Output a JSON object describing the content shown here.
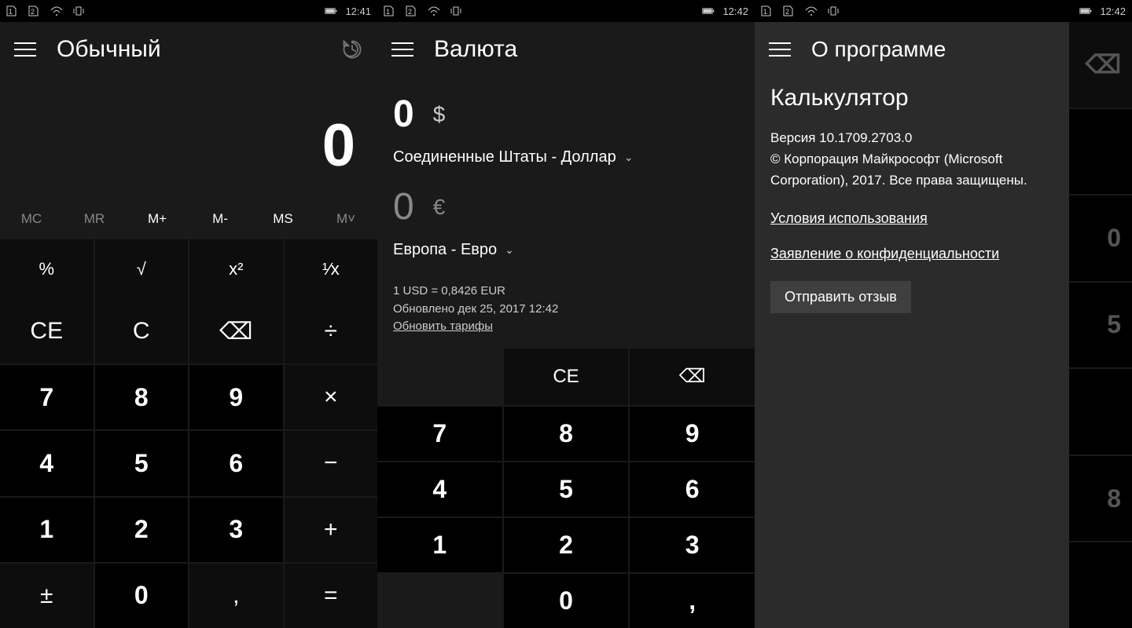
{
  "status": {
    "time1": "12:41",
    "time2": "12:42",
    "time3": "12:42"
  },
  "panel1": {
    "title": "Обычный",
    "display": "0",
    "mem": {
      "mc": "MC",
      "mr": "MR",
      "mplus": "M+",
      "mminus": "M-",
      "ms": "MS",
      "mv": "M˅"
    },
    "fn": {
      "pct": "%",
      "sqrt": "√",
      "sq": "x²",
      "inv": "¹∕x"
    },
    "keys": {
      "ce": "CE",
      "c": "C",
      "bs": "⌫",
      "div": "÷",
      "k7": "7",
      "k8": "8",
      "k9": "9",
      "mul": "×",
      "k4": "4",
      "k5": "5",
      "k6": "6",
      "sub": "−",
      "k1": "1",
      "k2": "2",
      "k3": "3",
      "add": "+",
      "pm": "±",
      "k0": "0",
      "dec": ",",
      "eq": "="
    }
  },
  "panel2": {
    "title": "Валюта",
    "val1": "0",
    "sym1": "$",
    "sel1": "Соединенные Штаты - Доллар",
    "val2": "0",
    "sym2": "€",
    "sel2": "Европа - Евро",
    "rate": "1 USD = 0,8426 EUR",
    "updated": "Обновлено дек 25, 2017 12:42",
    "refresh": "Обновить тарифы",
    "keys": {
      "ce": "CE",
      "bs": "⌫",
      "k7": "7",
      "k8": "8",
      "k9": "9",
      "k4": "4",
      "k5": "5",
      "k6": "6",
      "k1": "1",
      "k2": "2",
      "k3": "3",
      "k0": "0",
      "dec": ","
    }
  },
  "panel3": {
    "title": "О программе",
    "appname": "Калькулятор",
    "version": "Версия 10.1709.2703.0",
    "copyright": "© Корпорация Майкрософт (Microsoft Corporation), 2017. Все права защищены.",
    "terms": "Условия использования",
    "privacy": "Заявление о конфиденциальности",
    "feedback": "Отправить отзыв",
    "bgkeys": {
      "bs": "⌫",
      "k0": "0",
      "k5": "5",
      "k8": "8"
    }
  }
}
